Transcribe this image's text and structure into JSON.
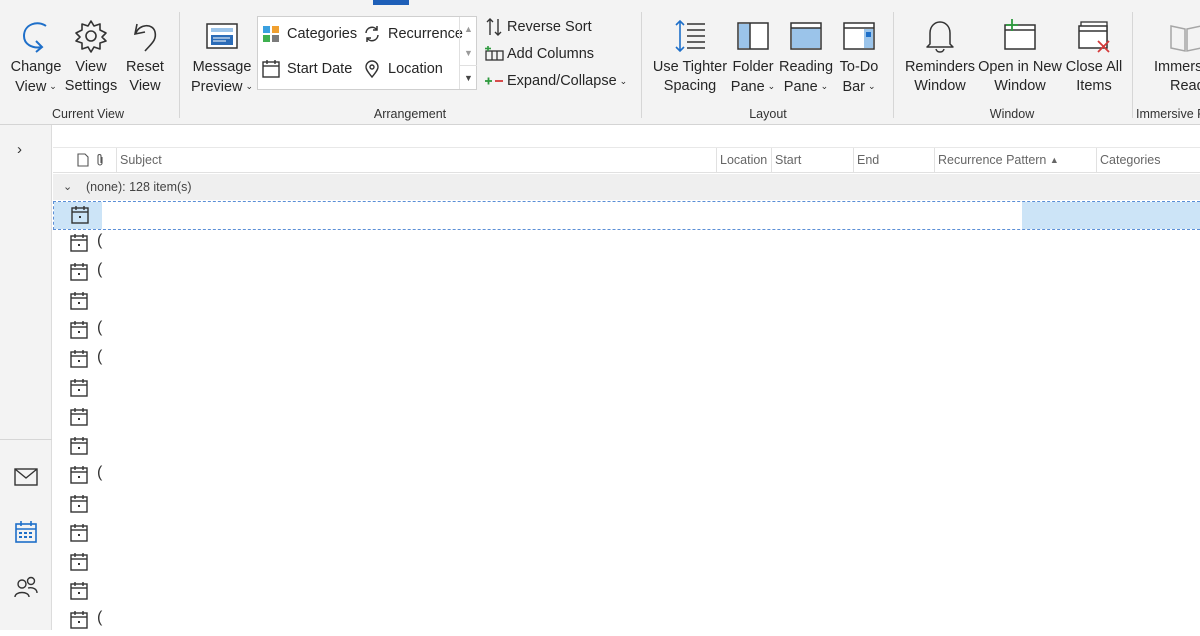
{
  "ribbon": {
    "current_view": {
      "label": "Current View",
      "change_view": [
        "Change",
        "View"
      ],
      "view_settings": [
        "View",
        "Settings"
      ],
      "reset_view": [
        "Reset",
        "View"
      ]
    },
    "arrangement": {
      "label": "Arrangement",
      "message_preview": [
        "Message",
        "Preview"
      ],
      "gallery": {
        "categories": "Categories",
        "recurrence": "Recurrence",
        "start_date": "Start Date",
        "location": "Location"
      },
      "reverse_sort": "Reverse Sort",
      "add_columns": "Add Columns",
      "expand_collapse": "Expand/Collapse"
    },
    "layout": {
      "label": "Layout",
      "tighter_spacing": [
        "Use Tighter",
        "Spacing"
      ],
      "folder_pane": [
        "Folder",
        "Pane"
      ],
      "reading_pane": [
        "Reading",
        "Pane"
      ],
      "todo_bar": [
        "To-Do",
        "Bar"
      ]
    },
    "window": {
      "label": "Window",
      "reminders": [
        "Reminders",
        "Window"
      ],
      "open_new": [
        "Open in New",
        "Window"
      ],
      "close_all": [
        "Close All",
        "Items"
      ]
    },
    "immersive": {
      "label": "Immersive R",
      "reader": [
        "Immers",
        "Reade"
      ]
    },
    "caret": "⌄"
  },
  "columns": {
    "subject": "Subject",
    "location": "Location",
    "start": "Start",
    "end": "End",
    "recurrence_pattern": "Recurrence Pattern",
    "sort_arrow": "▲",
    "categories": "Categories"
  },
  "group": {
    "chevron": "⌄",
    "title": "(none): 128 item(s)"
  },
  "rows": [
    {
      "paren": ""
    },
    {
      "paren": "("
    },
    {
      "paren": "("
    },
    {
      "paren": ""
    },
    {
      "paren": "("
    },
    {
      "paren": "("
    },
    {
      "paren": ""
    },
    {
      "paren": ""
    },
    {
      "paren": ""
    },
    {
      "paren": "("
    },
    {
      "paren": ""
    },
    {
      "paren": ""
    },
    {
      "paren": ""
    },
    {
      "paren": ""
    },
    {
      "paren": "("
    }
  ],
  "rail": {
    "expand": "›"
  },
  "colors": {
    "accent": "#1e5fb8",
    "selection": "#cce4f7",
    "ribbon_bg": "#f3f3f3"
  },
  "icons": [
    "undo-arrow-icon",
    "gear-icon",
    "reset-icon",
    "message-preview-icon",
    "categories-icon",
    "recurrence-icon",
    "calendar-icon",
    "location-pin-icon",
    "reverse-sort-icon",
    "add-columns-icon",
    "expand-collapse-icon",
    "tighter-spacing-icon",
    "folder-pane-icon",
    "reading-pane-icon",
    "todo-bar-icon",
    "bell-icon",
    "open-new-window-icon",
    "close-all-icon",
    "immersive-reader-icon",
    "mail-icon",
    "people-icon"
  ]
}
